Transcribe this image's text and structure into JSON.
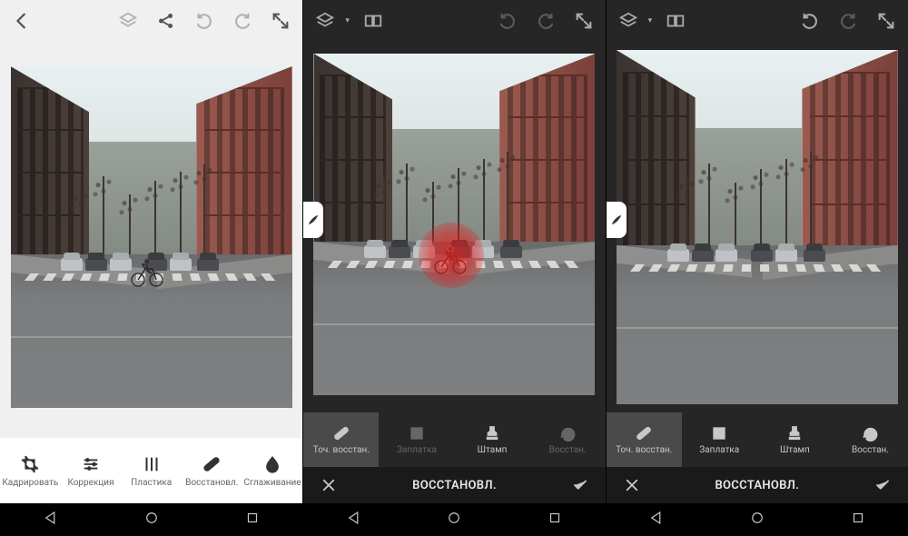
{
  "panels": [
    {
      "theme": "light",
      "tools": [
        {
          "label": "Кадрировать",
          "icon": "crop"
        },
        {
          "label": "Коррекция",
          "icon": "sliders"
        },
        {
          "label": "Пластика",
          "icon": "warp"
        },
        {
          "label": "Восстановл.",
          "icon": "heal"
        },
        {
          "label": "Сглаживание",
          "icon": "drop"
        }
      ]
    },
    {
      "theme": "dark",
      "confirm_title": "ВОССТАНОВЛ.",
      "subtools": [
        {
          "label": "Точ. восстан.",
          "icon": "heal",
          "active": true,
          "dim": false
        },
        {
          "label": "Заплатка",
          "icon": "patch",
          "active": false,
          "dim": true
        },
        {
          "label": "Штамп",
          "icon": "stamp",
          "active": false,
          "dim": false
        },
        {
          "label": "Восстан.",
          "icon": "revert",
          "active": false,
          "dim": true
        }
      ]
    },
    {
      "theme": "dark",
      "confirm_title": "ВОССТАНОВЛ.",
      "subtools": [
        {
          "label": "Точ. восстан.",
          "icon": "heal",
          "active": true,
          "dim": false
        },
        {
          "label": "Заплатка",
          "icon": "patch",
          "active": false,
          "dim": false
        },
        {
          "label": "Штамп",
          "icon": "stamp",
          "active": false,
          "dim": false
        },
        {
          "label": "Восстан.",
          "icon": "revert",
          "active": false,
          "dim": false
        }
      ]
    }
  ]
}
